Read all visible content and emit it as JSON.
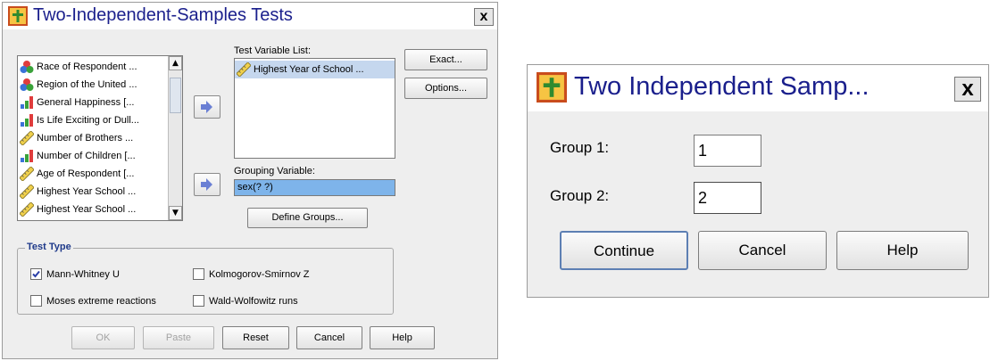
{
  "main_dialog": {
    "title": "Two-Independent-Samples Tests",
    "close": "x",
    "variables": [
      {
        "label": "Race of Respondent ...",
        "icon": "nominal-icon"
      },
      {
        "label": "Region of the United ...",
        "icon": "nominal-icon"
      },
      {
        "label": "General Happiness [...",
        "icon": "ordinal-icon"
      },
      {
        "label": "Is Life Exciting or Dull...",
        "icon": "ordinal-icon"
      },
      {
        "label": "Number of Brothers ...",
        "icon": "scale-icon"
      },
      {
        "label": "Number of Children [...",
        "icon": "ordinal-icon"
      },
      {
        "label": "Age of Respondent [...",
        "icon": "scale-icon"
      },
      {
        "label": "Highest Year School ...",
        "icon": "scale-icon"
      },
      {
        "label": "Highest Year School ...",
        "icon": "scale-icon"
      }
    ],
    "test_variable_label": "Test Variable List:",
    "test_variables": [
      {
        "label": "Highest Year of School ...",
        "icon": "scale-icon"
      }
    ],
    "grouping_label": "Grouping Variable:",
    "grouping_value": "sex(? ?)",
    "define_groups": "Define Groups...",
    "exact": "Exact...",
    "options": "Options...",
    "test_type": {
      "title": "Test Type",
      "options": [
        {
          "label": "Mann-Whitney U",
          "checked": true
        },
        {
          "label": "Kolmogorov-Smirnov Z",
          "checked": false
        },
        {
          "label": "Moses extreme reactions",
          "checked": false
        },
        {
          "label": "Wald-Wolfowitz runs",
          "checked": false
        }
      ]
    },
    "buttons": {
      "ok": "OK",
      "paste": "Paste",
      "reset": "Reset",
      "cancel": "Cancel",
      "help": "Help"
    }
  },
  "groups_dialog": {
    "title": "Two Independent Samp...",
    "close": "x",
    "group1_label": "Group 1:",
    "group1_value": "1",
    "group2_label": "Group 2:",
    "group2_value": "2",
    "buttons": {
      "continue": "Continue",
      "cancel": "Cancel",
      "help": "Help"
    }
  },
  "colors": {
    "title_text": "#1a1f8c",
    "group_title": "#1f3a8a",
    "grouping_highlight": "#7eb4ea",
    "selected_row": "#c5d7ee"
  }
}
